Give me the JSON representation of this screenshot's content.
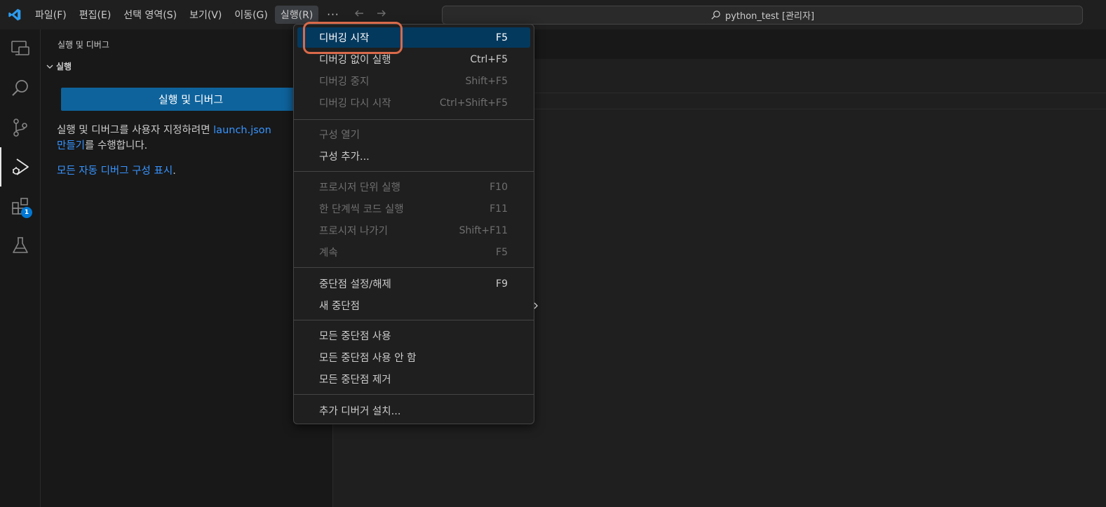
{
  "titlebar": {
    "menus": [
      "파일(F)",
      "편집(E)",
      "선택 영역(S)",
      "보기(V)",
      "이동(G)",
      "실행(R)"
    ],
    "more": "···",
    "command_center": "python_test [관리자]"
  },
  "activitybar": {
    "items": [
      "remote-explorer-icon",
      "search-icon",
      "source-control-icon",
      "run-debug-icon",
      "extensions-icon",
      "testing-icon"
    ],
    "extensions_badge": "1"
  },
  "sidebar": {
    "title": "실행 및 디버그",
    "section": "실행",
    "run_button": "실행 및 디버그",
    "help_prefix": "실행 및 디버그를 사용자 지정하려면 ",
    "help_link1": "launch.json ",
    "help_link2": "만들기",
    "help_suffix": "를 수행합니다.",
    "show_all_link": "모든 자동 디버그 구성 표시",
    "show_all_suffix": "."
  },
  "run_menu": {
    "items": [
      {
        "label": "디버깅 시작",
        "shortcut": "F5"
      },
      {
        "label": "디버깅 없이 실행",
        "shortcut": "Ctrl+F5"
      },
      {
        "label": "디버깅 중지",
        "shortcut": "Shift+F5"
      },
      {
        "label": "디버깅 다시 시작",
        "shortcut": "Ctrl+Shift+F5"
      },
      {
        "label": "구성 열기",
        "shortcut": ""
      },
      {
        "label": "구성 추가...",
        "shortcut": ""
      },
      {
        "label": "프로시저 단위 실행",
        "shortcut": "F10"
      },
      {
        "label": "한 단계씩 코드 실행",
        "shortcut": "F11"
      },
      {
        "label": "프로시저 나가기",
        "shortcut": "Shift+F11"
      },
      {
        "label": "계속",
        "shortcut": "F5"
      },
      {
        "label": "중단점 설정/해제",
        "shortcut": "F9"
      },
      {
        "label": "새 중단점",
        "shortcut": ""
      },
      {
        "label": "모든 중단점 사용",
        "shortcut": ""
      },
      {
        "label": "모든 중단점 사용 안 함",
        "shortcut": ""
      },
      {
        "label": "모든 중단점 제거",
        "shortcut": ""
      },
      {
        "label": "추가 디버거 설치...",
        "shortcut": ""
      }
    ]
  },
  "colors": {
    "accent_button": "#0e639c",
    "menu_highlight": "#04395e",
    "link": "#3794ff",
    "annotation_ring": "#d96a4a",
    "badge": "#0078d4"
  }
}
